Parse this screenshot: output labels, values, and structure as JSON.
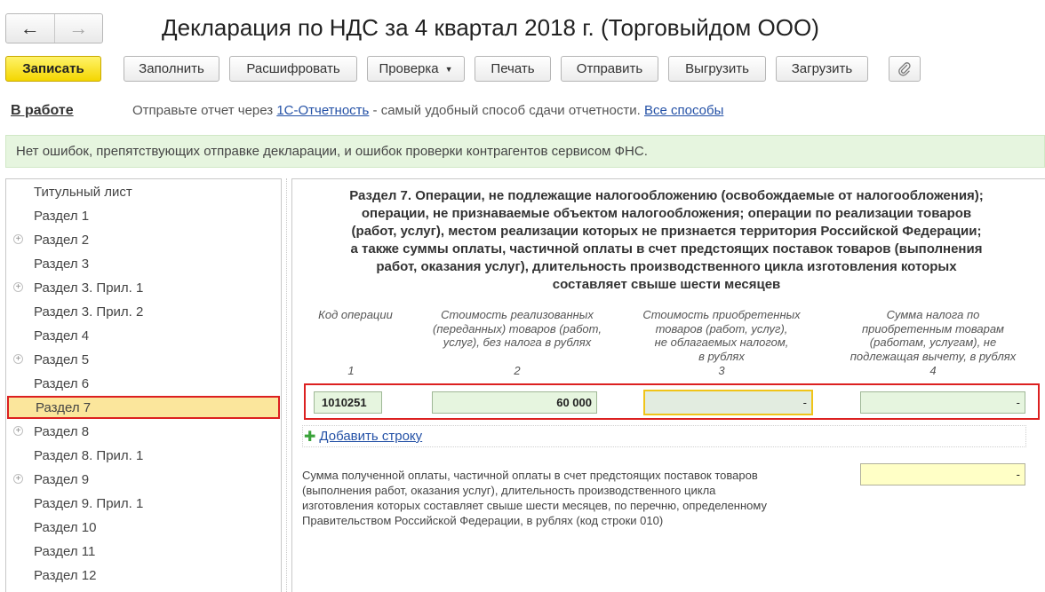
{
  "window": {
    "title": "Декларация по НДС за 4 квартал 2018 г. (Торговыйдом ООО)"
  },
  "nav": {
    "back_icon": "←",
    "forward_icon": "→"
  },
  "toolbar": {
    "save": "Записать",
    "fill": "Заполнить",
    "decode": "Расшифровать",
    "check": "Проверка",
    "print": "Печать",
    "send": "Отправить",
    "unload": "Выгрузить",
    "load": "Загрузить",
    "attach_icon": "paperclip-icon"
  },
  "status": {
    "state": "В работе",
    "hint_prefix": "Отправьте отчет через",
    "hint_link": "1С-Отчетность",
    "hint_middle": "- самый удобный способ сдачи отчетности.",
    "hint_all": "Все способы"
  },
  "notice": "Нет ошибок, препятствующих отправке декларации, и ошибок проверки контрагентов сервисом ФНС.",
  "sidebar": {
    "items": [
      {
        "label": "Титульный лист",
        "expandable": false
      },
      {
        "label": "Раздел 1",
        "expandable": false
      },
      {
        "label": "Раздел 2",
        "expandable": true
      },
      {
        "label": "Раздел 3",
        "expandable": false
      },
      {
        "label": "Раздел 3. Прил. 1",
        "expandable": true
      },
      {
        "label": "Раздел 3. Прил. 2",
        "expandable": false
      },
      {
        "label": "Раздел 4",
        "expandable": false
      },
      {
        "label": "Раздел 5",
        "expandable": true
      },
      {
        "label": "Раздел 6",
        "expandable": false
      },
      {
        "label": "Раздел 7",
        "expandable": false,
        "selected": true
      },
      {
        "label": "Раздел 8",
        "expandable": true
      },
      {
        "label": "Раздел 8. Прил. 1",
        "expandable": false
      },
      {
        "label": "Раздел 9",
        "expandable": true
      },
      {
        "label": "Раздел 9. Прил. 1",
        "expandable": false
      },
      {
        "label": "Раздел 10",
        "expandable": false
      },
      {
        "label": "Раздел 11",
        "expandable": false
      },
      {
        "label": "Раздел 12",
        "expandable": false
      }
    ]
  },
  "section": {
    "title_lines": [
      "Раздел 7. Операции, не подлежащие налогообложению (освобождаемые от налогообложения);",
      "операции, не признаваемые объектом налогообложения; операции по реализации товаров",
      "(работ, услуг), местом реализации которых не признается территория Российской Федерации;",
      "а также суммы оплаты, частичной оплаты в счет предстоящих поставок товаров (выполнения",
      "работ, оказания услуг), длительность производственного цикла изготовления которых",
      "составляет свыше шести месяцев"
    ],
    "columns": [
      {
        "lines": [
          "Код операции"
        ],
        "num": "1"
      },
      {
        "lines": [
          "Стоимость реализованных",
          "(переданных) товаров (работ,",
          "услуг), без налога в рублях"
        ],
        "num": "2"
      },
      {
        "lines": [
          "Стоимость приобретенных",
          "товаров (работ, услуг),",
          "не облагаемых налогом,",
          "в рублях"
        ],
        "num": "3"
      },
      {
        "lines": [
          "Сумма налога по",
          "приобретенным товарам",
          "(работам, услугам), не",
          "подлежащая вычету, в рублях"
        ],
        "num": "4"
      }
    ],
    "row": {
      "code": "1010251",
      "sales_cost": "60 000",
      "purchase_cost": "-",
      "tax_not_deductible": "-"
    },
    "add_row": "Добавить строку",
    "note_lines": [
      "Сумма полученной оплаты, частичной оплаты в счет предстоящих поставок товаров",
      "(выполнения работ, оказания услуг), длительность производственного цикла",
      "изготовления которых составляет свыше шести месяцев, по перечню, определенному",
      "Правительством Российской Федерации, в рублях (код строки 010)"
    ],
    "note_value": "-"
  },
  "colors": {
    "save_yellow": "#f4d600",
    "notice_green": "#e6f5df",
    "selection_red": "#dc2020",
    "selected_item": "#fbe69c",
    "link_blue": "#2451a6"
  }
}
